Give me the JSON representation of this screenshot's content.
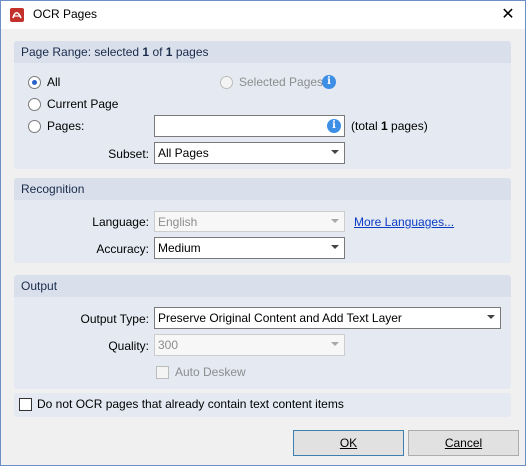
{
  "window": {
    "title": "OCR Pages",
    "close_glyph": "✕"
  },
  "page_range": {
    "header_prefix": "Page Range: selected ",
    "selected": "1",
    "of_text": " of ",
    "total": "1",
    "pages_suffix": " pages",
    "options": {
      "all": "All",
      "current": "Current Page",
      "pages": "Pages:",
      "selected_pages": "Selected Pages"
    },
    "pages_input_value": "",
    "total_prefix": "(total ",
    "total_count": "1",
    "total_suffix": " pages)",
    "subset_label": "Subset:",
    "subset_value": "All Pages"
  },
  "recognition": {
    "header": "Recognition",
    "language_label": "Language:",
    "language_value": "English",
    "more_languages": "More Languages...",
    "accuracy_label": "Accuracy:",
    "accuracy_value": "Medium"
  },
  "output": {
    "header": "Output",
    "type_label": "Output Type:",
    "type_value": "Preserve Original Content and Add Text Layer",
    "quality_label": "Quality:",
    "quality_value": "300",
    "deskew_label": "Auto Deskew"
  },
  "skip_text_pages": "Do not OCR pages that already contain text content items",
  "buttons": {
    "ok": "OK",
    "cancel": "Cancel"
  },
  "colors": {
    "accent": "#2a62c9",
    "info": "#3d8fe6",
    "link": "#0b3cc4",
    "group_bg": "#e4e9f2"
  }
}
